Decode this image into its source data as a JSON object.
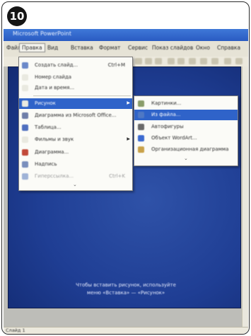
{
  "step_number": "10",
  "window": {
    "title": "Microsoft PowerPoint"
  },
  "menubar": {
    "items": [
      "Файл",
      "Правка",
      "Вид",
      "Вставка",
      "Формат",
      "Сервис",
      "Показ слайдов",
      "Окно",
      "Справка"
    ],
    "open_index": 1
  },
  "insert_menu": {
    "items": [
      {
        "label": "Создать слайд...",
        "shortcut": "Ctrl+M",
        "icon": "new-slide-icon",
        "icon_color": "#6b89c9"
      },
      {
        "label": "Номер слайда",
        "icon": "slide-number-icon",
        "icon_color": "#e9e9e0"
      },
      {
        "label": "Дата и время...",
        "icon": "date-time-icon",
        "icon_color": "#e9e9e0"
      },
      {
        "label": "Рисунок",
        "icon": "picture-icon",
        "icon_color": "#e9e9e0",
        "highlighted": true,
        "has_submenu": true
      },
      {
        "label": "Диаграмма из Microsoft Office...",
        "icon": "chart-icon",
        "icon_color": "#6f7ea9"
      },
      {
        "label": "Таблица...",
        "icon": "table-icon",
        "icon_color": "#4f6fbf"
      },
      {
        "label": "Фильмы и звук",
        "icon": "movie-sound-icon",
        "icon_color": "#e9e9e0",
        "has_submenu": true
      },
      {
        "label": "Диаграмма...",
        "icon": "diagram-icon",
        "icon_color": "#c24a3a"
      },
      {
        "label": "Надпись",
        "icon": "text-box-icon",
        "icon_color": "#7a8fbd"
      },
      {
        "label": "Гиперссылка...",
        "shortcut": "Ctrl+K",
        "icon": "hyperlink-icon",
        "icon_color": "#9fb3d6",
        "dimmed": true
      }
    ],
    "more_glyph": "⌄"
  },
  "picture_submenu": {
    "items": [
      {
        "label": "Картинки...",
        "icon": "clipart-icon",
        "icon_color": "#8a9d6a"
      },
      {
        "label": "Из файла...",
        "icon": "from-file-icon",
        "icon_color": "#4f78c4",
        "highlighted": true
      },
      {
        "label": "Автофигуры",
        "icon": "autoshapes-icon",
        "icon_color": "#6a6a6a"
      },
      {
        "label": "Объект WordArt...",
        "icon": "wordart-icon",
        "icon_color": "#3b6ad0"
      },
      {
        "label": "Организационная диаграмма",
        "icon": "org-chart-icon",
        "icon_color": "#c9a24a"
      }
    ],
    "more_glyph": "⌄"
  },
  "slide": {
    "caption_line1": "Чтобы вставить рисунок, используйте",
    "caption_line2": "меню «Вставка» — «Рисунок»"
  },
  "statusbar": {
    "text": "Слайд 1"
  },
  "colors": {
    "titlebar": "#2f64c9",
    "menu_highlight": "#2f63c9",
    "slide_background": "#1f3e94"
  }
}
